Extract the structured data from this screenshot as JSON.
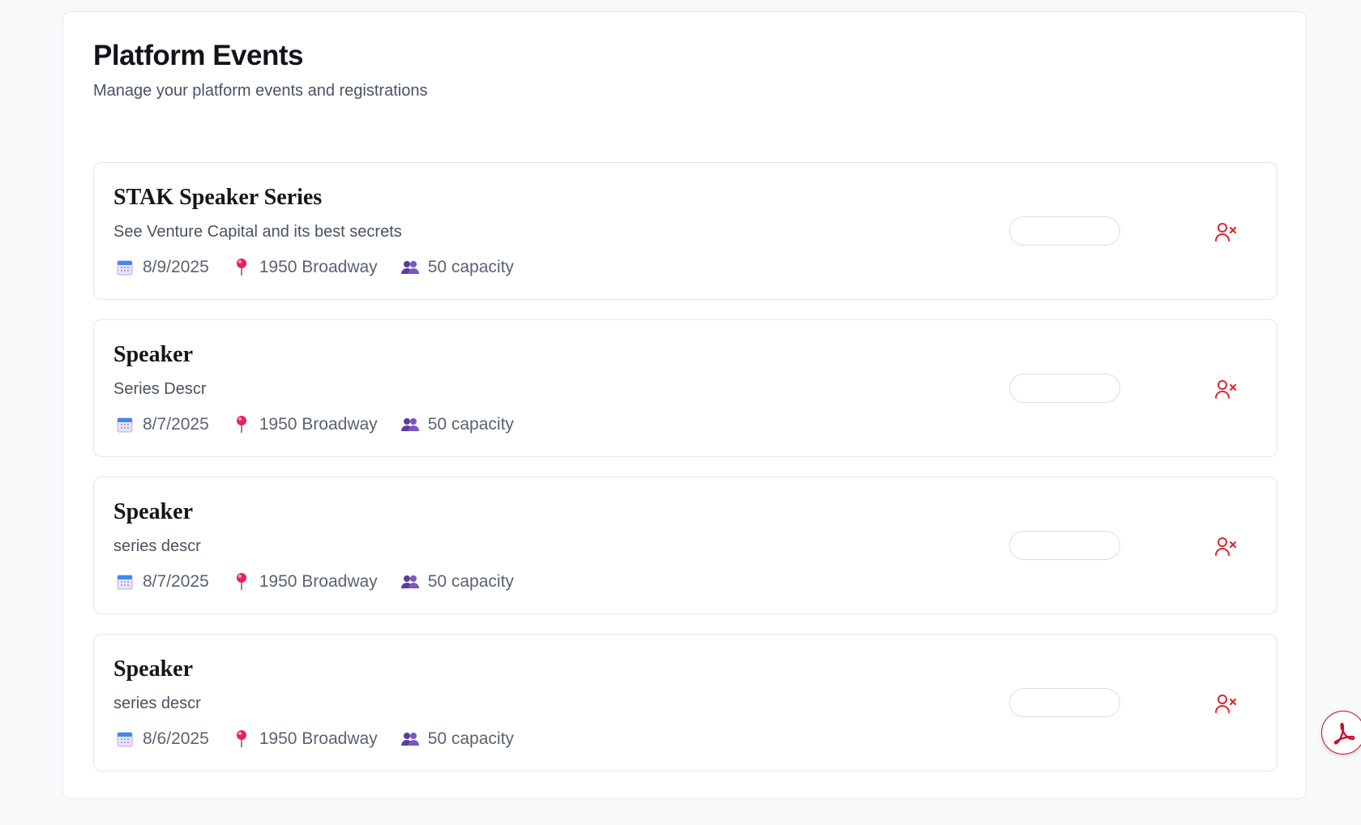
{
  "header": {
    "title": "Platform Events",
    "subtitle": "Manage your platform events and registrations"
  },
  "events": [
    {
      "title": "STAK Speaker Series",
      "description": "See Venture Capital and its best secrets",
      "date": "8/9/2025",
      "location": "1950 Broadway",
      "capacity": "50 capacity"
    },
    {
      "title": "Speaker",
      "description": "Series Descr",
      "date": "8/7/2025",
      "location": "1950 Broadway",
      "capacity": "50 capacity"
    },
    {
      "title": "Speaker",
      "description": "series descr",
      "date": "8/7/2025",
      "location": "1950 Broadway",
      "capacity": "50 capacity"
    },
    {
      "title": "Speaker",
      "description": "series descr",
      "date": "8/6/2025",
      "location": "1950 Broadway",
      "capacity": "50 capacity"
    }
  ],
  "icons": {
    "date": "calendar-icon",
    "location": "pin-icon",
    "capacity": "people-icon",
    "remove": "user-remove-icon",
    "fab": "pdf-icon"
  },
  "colors": {
    "remove_icon": "#e0242f",
    "pin": "#e91e63",
    "people": "#5b3d9c",
    "pdf": "#c8102e"
  }
}
